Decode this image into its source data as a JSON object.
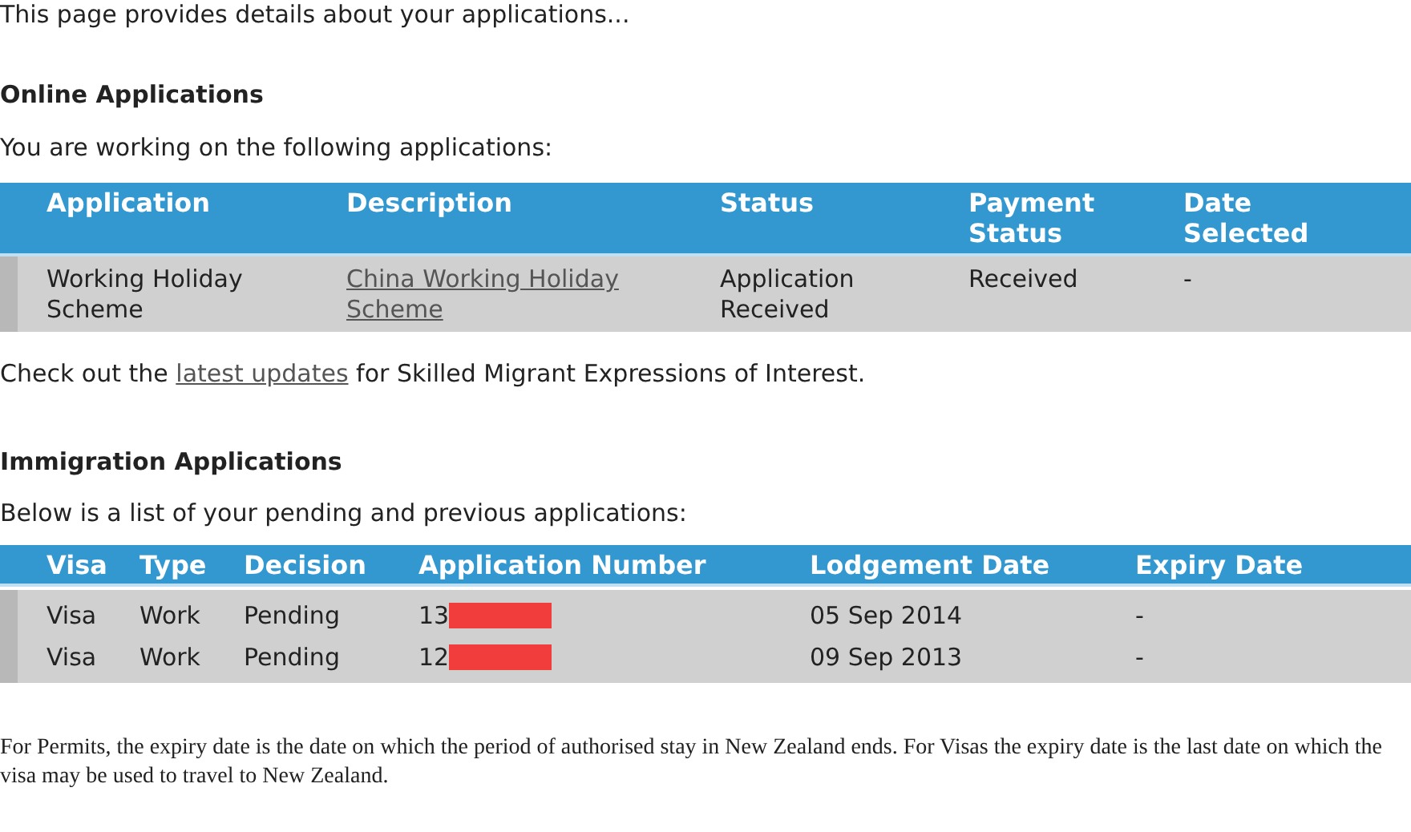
{
  "intro": "This page provides details about your applications...",
  "online": {
    "heading": "Online Applications",
    "subtitle": "You are working on the following applications:",
    "columns": [
      "Application",
      "Description",
      "Status",
      "Payment Status",
      "Date Selected"
    ],
    "rows": [
      {
        "application": "Working Holiday Scheme",
        "description": "China Working Holiday Scheme",
        "status": "Application Received",
        "payment_status": "Received",
        "date_selected": "-"
      }
    ]
  },
  "updates_note": {
    "before": "Check out the",
    "link": "latest updates",
    "after": "for Skilled Migrant Expressions of Interest."
  },
  "immigration": {
    "heading": "Immigration Applications",
    "subtitle": "Below is a list of your pending and previous applications:",
    "columns": [
      "Visa",
      "Type",
      "Decision",
      "Application Number",
      "Lodgement Date",
      "Expiry Date"
    ],
    "rows": [
      {
        "visa": "Visa",
        "type": "Work",
        "decision": "Pending",
        "application_number": "13",
        "redacted": true,
        "lodgement_date": "05 Sep 2014",
        "expiry_date": "-"
      },
      {
        "visa": "Visa",
        "type": "Work",
        "decision": "Pending",
        "application_number": "12",
        "redacted": true,
        "lodgement_date": "09 Sep 2013",
        "expiry_date": "-"
      }
    ]
  },
  "footnote": "For Permits, the expiry date is the date on which the period of authorised stay in New Zealand ends. For Visas the expiry date is the last date on which the visa may be used to travel to New Zealand."
}
